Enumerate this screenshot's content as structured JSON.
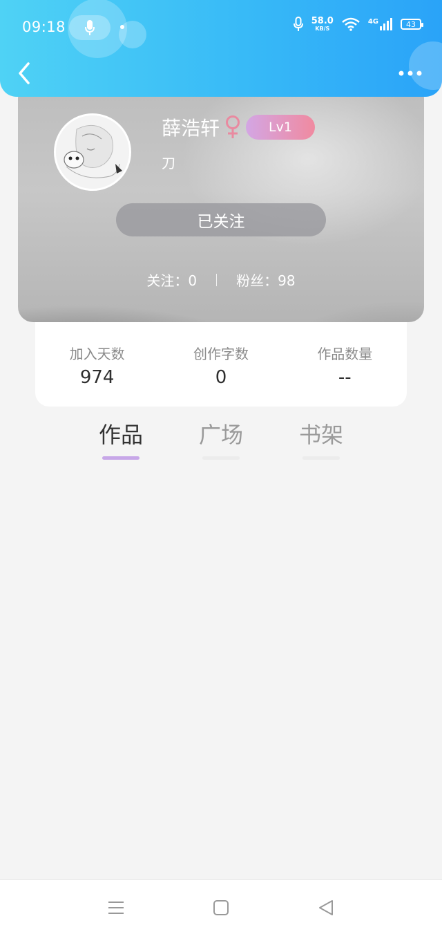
{
  "status_bar": {
    "time": "09:18",
    "network_speed_value": "58.0",
    "network_speed_unit": "KB/S",
    "network_type": "4G",
    "battery": "43"
  },
  "profile": {
    "name": "薛浩轩",
    "gender_icon": "female-icon",
    "level": "Lv1",
    "signature": "刀",
    "follow_button_label": "已关注",
    "following_label": "关注：0",
    "followers_label": "粉丝：98"
  },
  "stats": [
    {
      "label": "加入天数",
      "value": "974"
    },
    {
      "label": "创作字数",
      "value": "0"
    },
    {
      "label": "作品数量",
      "value": "--"
    }
  ],
  "tabs": [
    {
      "label": "作品",
      "active": true
    },
    {
      "label": "广场",
      "active": false
    },
    {
      "label": "书架",
      "active": false
    }
  ],
  "icons": {
    "back": "chevron-left-icon",
    "more": "more-dots-icon",
    "nav_menu": "menu-icon",
    "nav_home": "home-square-icon",
    "nav_back": "back-triangle-icon"
  },
  "colors": {
    "header_start": "#4fd2f5",
    "header_end": "#2aa3f8",
    "level_badge_start": "#d3a6e4",
    "level_badge_end": "#f08aa0",
    "gender_icon": "#e98aa0",
    "tab_indicator_active": "#c7a7e8"
  }
}
